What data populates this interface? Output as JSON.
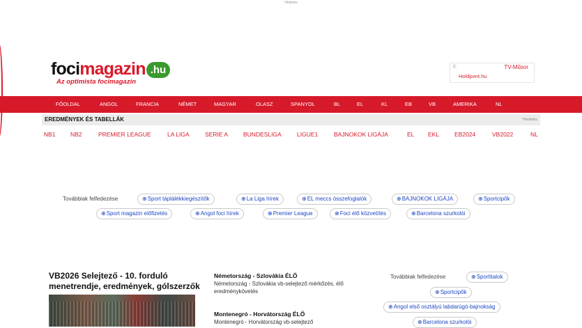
{
  "ad": {
    "label": "Hirdetés"
  },
  "header": {
    "logo_part1": "foci",
    "logo_part2": "magazin",
    "logo_tld": ".hu",
    "slogan": "Az optimista focimagazin",
    "tv_label": "TV-Műsor",
    "tv_link": "Holdpont.hu",
    "ad_icon": "ad-choices-icon"
  },
  "nav": {
    "items": [
      "FŐOLDAL",
      "ANGOL",
      "FRANCIA",
      "NÉMET",
      "MAGYAR",
      "OLASZ",
      "SPANYOL",
      "BL",
      "EL",
      "KL",
      "EB",
      "VB",
      "AMERIKA",
      "NL"
    ]
  },
  "results": {
    "title": "EREDMÉNYEK ÉS TABELLÁK",
    "ad_label": "^hirdetés"
  },
  "tabs": [
    "NB1",
    "NB2",
    "PREMIER LEAGUE",
    "LA LIGA",
    "SERIE A",
    "BUNDESLIGA",
    "LIGUE1",
    "BAJNOKOK LIGÁJA",
    "EL",
    "EKL",
    "EB2024",
    "VB2022",
    "NL"
  ],
  "explore": {
    "label": "Továbbiak felfedezése",
    "row1": [
      "Sport táplálékkiegészítők",
      "La Liga hírek",
      "EL meccs összefoglalók",
      "BAJNOKOK LIGÁJA",
      "Sportcipők"
    ],
    "row2": [
      "Sport magazin előfizetés",
      "Angol foci hírek",
      "Premier League",
      "Foci élő közvetítés",
      "Barcelona szurkolói"
    ]
  },
  "article": {
    "title": "VB2026 Selejtező - 10. forduló menetrendje, eredmények, gólszerzők"
  },
  "news": [
    {
      "title": "Németország - Szlovákia ÉLŐ",
      "desc": "Németország - Szlovákia vb-selejtező mérkőzés, élő eredménykövetés"
    },
    {
      "title": "Montenegró - Horvátország ÉLŐ",
      "desc": "Montenegró - Horvátország vb-selejtező"
    }
  ],
  "side_explore": {
    "label": "Továbbiak felfedezése",
    "items": [
      "Sportitalok",
      "Sportcipők",
      "Angol első osztályú labdarúgó-bajnokság",
      "Barcelona szurkolói"
    ]
  },
  "colors": {
    "brand_red": "#d71a2a",
    "green": "#3a9a2e",
    "link_blue": "#1f47c2"
  }
}
